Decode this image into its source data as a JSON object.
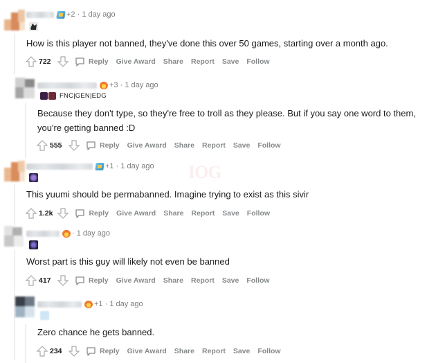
{
  "comments": [
    {
      "meta": "+2 · 1 day ago",
      "award": "gem",
      "flair_text": "",
      "body": [
        "How is this player not banned, they've done this over 50 games, starting over a month ago."
      ],
      "score": "722"
    },
    {
      "meta": "+3 · 1 day ago",
      "award": "fire",
      "flair_text": "FNC|GEN|EDG",
      "body": [
        "Because they don't type, so they're free to troll as they please. But if you say one word to them,",
        "you're getting banned :D"
      ],
      "score": "555"
    },
    {
      "meta": "+1 · 1 day ago",
      "award": "gem",
      "flair_text": "",
      "body": [
        "This yuumi should be permabanned. Imagine trying to exist as this sivir"
      ],
      "score": "1.2k"
    },
    {
      "meta": "· 1 day ago",
      "award": "fire",
      "flair_text": "",
      "body": [
        "Worst part is this guy will likely not even be banned"
      ],
      "score": "417"
    },
    {
      "meta": "+1 · 1 day ago",
      "award": "fire",
      "flair_text": "",
      "body": [
        "Zero chance he gets banned."
      ],
      "score": "234"
    }
  ],
  "actions": {
    "reply": "Reply",
    "give_award": "Give Award",
    "share": "Share",
    "report": "Report",
    "save": "Save",
    "follow": "Follow"
  },
  "icons": {
    "upvote": "arrow-up-icon",
    "downvote": "arrow-down-icon",
    "reply": "chat-bubble-icon"
  },
  "colors": {
    "meta": "#7c7c7c",
    "action": "#878a8c",
    "text": "#1c1c1c",
    "thread_line": "#edeff1"
  }
}
